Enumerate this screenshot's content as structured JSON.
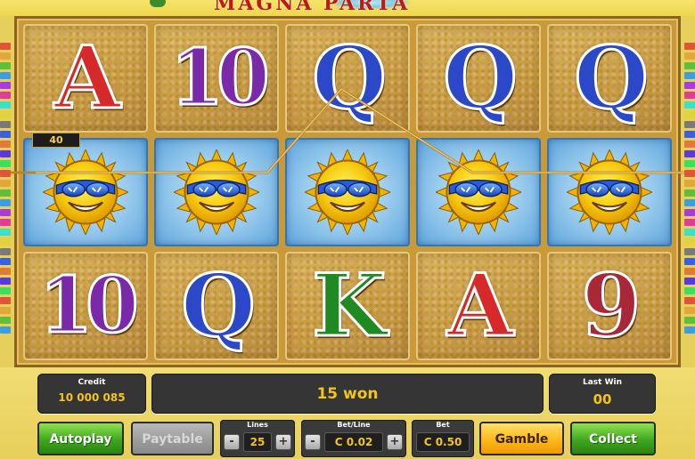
{
  "banner": {
    "title": "MAGNA PARTA"
  },
  "win_indicator": "40",
  "reels": [
    [
      {
        "symbol": "A",
        "color": "red"
      },
      {
        "symbol": "sun"
      },
      {
        "symbol": "10",
        "color": "purple"
      }
    ],
    [
      {
        "symbol": "10",
        "color": "purple"
      },
      {
        "symbol": "sun"
      },
      {
        "symbol": "Q",
        "color": "blue"
      }
    ],
    [
      {
        "symbol": "Q",
        "color": "blue"
      },
      {
        "symbol": "sun"
      },
      {
        "symbol": "K",
        "color": "green"
      }
    ],
    [
      {
        "symbol": "Q",
        "color": "blue"
      },
      {
        "symbol": "sun"
      },
      {
        "symbol": "A",
        "color": "red"
      }
    ],
    [
      {
        "symbol": "Q",
        "color": "blue"
      },
      {
        "symbol": "sun"
      },
      {
        "symbol": "9",
        "color": "maroon"
      }
    ]
  ],
  "info": {
    "credit_label": "Credit",
    "credit_value": "10 000 085",
    "win_message": "15 won",
    "last_win_label": "Last Win",
    "last_win_value": "00"
  },
  "controls": {
    "autoplay_label": "Autoplay",
    "paytable_label": "Paytable",
    "lines_label": "Lines",
    "lines_value": "25",
    "betline_label": "Bet/Line",
    "betline_value": "C 0.02",
    "bet_label": "Bet",
    "bet_value": "C 0.50",
    "gamble_label": "Gamble",
    "collect_label": "Collect",
    "minus": "-",
    "plus": "+"
  },
  "colors": {
    "red": "#d62a2a",
    "purple": "#7a2aa8",
    "blue": "#2a48c8",
    "green": "#1f8a22",
    "maroon": "#a8283a",
    "gold": "#f3c419"
  }
}
